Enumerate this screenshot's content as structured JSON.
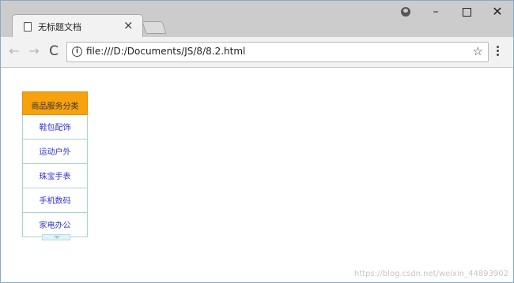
{
  "browser": {
    "tab_title": "无标题文档",
    "tab_close": "×",
    "url": "file:///D:/Documents/JS/8/8.2.html",
    "back": "←",
    "forward": "→",
    "reload": "C",
    "star": "☆",
    "info": "i",
    "minimize": "–",
    "close": "✕"
  },
  "menu": {
    "header": "商品服务分类",
    "items": [
      "鞋包配饰",
      "运动户外",
      "珠宝手表",
      "手机数码",
      "家电办公"
    ]
  },
  "watermark": "https://blog.csdn.net/weixin_44893902",
  "colors": {
    "header_bg": "#f7a10c",
    "item_border": "#a7d7c7",
    "item_text": "#3333cc"
  }
}
